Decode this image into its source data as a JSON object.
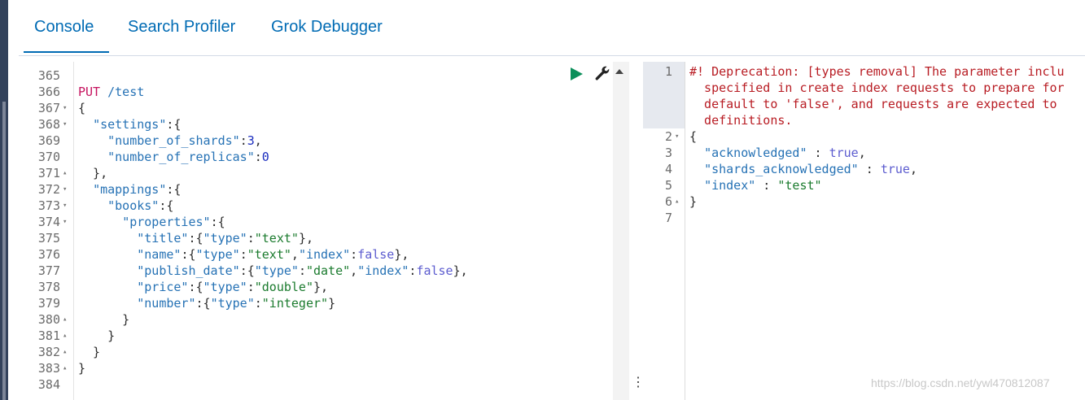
{
  "tabs": [
    "Console",
    "Search Profiler",
    "Grok Debugger"
  ],
  "active_tab": "Console",
  "editor": {
    "lines": [
      {
        "n": "365",
        "fold": "",
        "parts": []
      },
      {
        "n": "366",
        "fold": "",
        "parts": [
          [
            "method",
            "PUT"
          ],
          [
            "p",
            " "
          ],
          [
            "url",
            "/test"
          ]
        ]
      },
      {
        "n": "367",
        "fold": "down",
        "parts": [
          [
            "p",
            "{"
          ]
        ]
      },
      {
        "n": "368",
        "fold": "down",
        "parts": [
          [
            "p",
            "  "
          ],
          [
            "key",
            "\"settings\""
          ],
          [
            "p",
            ":{"
          ]
        ]
      },
      {
        "n": "369",
        "fold": "",
        "parts": [
          [
            "p",
            "    "
          ],
          [
            "key",
            "\"number_of_shards\""
          ],
          [
            "p",
            ":"
          ],
          [
            "num",
            "3"
          ],
          [
            "p",
            ","
          ]
        ]
      },
      {
        "n": "370",
        "fold": "",
        "parts": [
          [
            "p",
            "    "
          ],
          [
            "key",
            "\"number_of_replicas\""
          ],
          [
            "p",
            ":"
          ],
          [
            "num",
            "0"
          ]
        ]
      },
      {
        "n": "371",
        "fold": "up",
        "parts": [
          [
            "p",
            "  },"
          ]
        ]
      },
      {
        "n": "372",
        "fold": "down",
        "parts": [
          [
            "p",
            "  "
          ],
          [
            "key",
            "\"mappings\""
          ],
          [
            "p",
            ":{"
          ]
        ]
      },
      {
        "n": "373",
        "fold": "down",
        "parts": [
          [
            "p",
            "    "
          ],
          [
            "key",
            "\"books\""
          ],
          [
            "p",
            ":{"
          ]
        ]
      },
      {
        "n": "374",
        "fold": "down",
        "parts": [
          [
            "p",
            "      "
          ],
          [
            "key",
            "\"properties\""
          ],
          [
            "p",
            ":{"
          ]
        ]
      },
      {
        "n": "375",
        "fold": "",
        "parts": [
          [
            "p",
            "        "
          ],
          [
            "key",
            "\"title\""
          ],
          [
            "p",
            ":{"
          ],
          [
            "key",
            "\"type\""
          ],
          [
            "p",
            ":"
          ],
          [
            "str",
            "\"text\""
          ],
          [
            "p",
            "},"
          ]
        ]
      },
      {
        "n": "376",
        "fold": "",
        "parts": [
          [
            "p",
            "        "
          ],
          [
            "key",
            "\"name\""
          ],
          [
            "p",
            ":{"
          ],
          [
            "key",
            "\"type\""
          ],
          [
            "p",
            ":"
          ],
          [
            "str",
            "\"text\""
          ],
          [
            "p",
            ","
          ],
          [
            "key",
            "\"index\""
          ],
          [
            "p",
            ":"
          ],
          [
            "bool",
            "false"
          ],
          [
            "p",
            "},"
          ]
        ]
      },
      {
        "n": "377",
        "fold": "",
        "parts": [
          [
            "p",
            "        "
          ],
          [
            "key",
            "\"publish_date\""
          ],
          [
            "p",
            ":{"
          ],
          [
            "key",
            "\"type\""
          ],
          [
            "p",
            ":"
          ],
          [
            "str",
            "\"date\""
          ],
          [
            "p",
            ","
          ],
          [
            "key",
            "\"index\""
          ],
          [
            "p",
            ":"
          ],
          [
            "bool",
            "false"
          ],
          [
            "p",
            "},"
          ]
        ]
      },
      {
        "n": "378",
        "fold": "",
        "parts": [
          [
            "p",
            "        "
          ],
          [
            "key",
            "\"price\""
          ],
          [
            "p",
            ":{"
          ],
          [
            "key",
            "\"type\""
          ],
          [
            "p",
            ":"
          ],
          [
            "str",
            "\"double\""
          ],
          [
            "p",
            "},"
          ]
        ]
      },
      {
        "n": "379",
        "fold": "",
        "parts": [
          [
            "p",
            "        "
          ],
          [
            "key",
            "\"number\""
          ],
          [
            "p",
            ":{"
          ],
          [
            "key",
            "\"type\""
          ],
          [
            "p",
            ":"
          ],
          [
            "str",
            "\"integer\""
          ],
          [
            "p",
            "}"
          ]
        ]
      },
      {
        "n": "380",
        "fold": "up",
        "parts": [
          [
            "p",
            "      }"
          ]
        ]
      },
      {
        "n": "381",
        "fold": "up",
        "parts": [
          [
            "p",
            "    }"
          ]
        ]
      },
      {
        "n": "382",
        "fold": "up",
        "parts": [
          [
            "p",
            "  }"
          ]
        ]
      },
      {
        "n": "383",
        "fold": "up",
        "parts": [
          [
            "p",
            "}"
          ]
        ]
      },
      {
        "n": "384",
        "fold": "",
        "parts": []
      }
    ]
  },
  "output": {
    "lines": [
      {
        "n": "1",
        "fold": "",
        "parts": [
          [
            "warn",
            "#! Deprecation: [types removal] The parameter inclu"
          ]
        ]
      },
      {
        "n": "",
        "fold": "",
        "parts": [
          [
            "warn",
            "  specified in create index requests to prepare for"
          ]
        ]
      },
      {
        "n": "",
        "fold": "",
        "parts": [
          [
            "warn",
            "  default to 'false', and requests are expected to "
          ]
        ]
      },
      {
        "n": "",
        "fold": "",
        "parts": [
          [
            "warn",
            "  definitions."
          ]
        ]
      },
      {
        "n": "2",
        "fold": "down",
        "parts": [
          [
            "p",
            "{"
          ]
        ]
      },
      {
        "n": "3",
        "fold": "",
        "parts": [
          [
            "p",
            "  "
          ],
          [
            "key",
            "\"acknowledged\""
          ],
          [
            "p",
            " : "
          ],
          [
            "bool",
            "true"
          ],
          [
            "p",
            ","
          ]
        ]
      },
      {
        "n": "4",
        "fold": "",
        "parts": [
          [
            "p",
            "  "
          ],
          [
            "key",
            "\"shards_acknowledged\""
          ],
          [
            "p",
            " : "
          ],
          [
            "bool",
            "true"
          ],
          [
            "p",
            ","
          ]
        ]
      },
      {
        "n": "5",
        "fold": "",
        "parts": [
          [
            "p",
            "  "
          ],
          [
            "key",
            "\"index\""
          ],
          [
            "p",
            " : "
          ],
          [
            "str",
            "\"test\""
          ]
        ]
      },
      {
        "n": "6",
        "fold": "up",
        "parts": [
          [
            "p",
            "}"
          ]
        ]
      },
      {
        "n": "7",
        "fold": "",
        "parts": []
      }
    ]
  },
  "icons": {
    "run": "play-icon",
    "settings": "wrench-icon"
  },
  "watermark": "https://blog.csdn.net/ywl470812087"
}
